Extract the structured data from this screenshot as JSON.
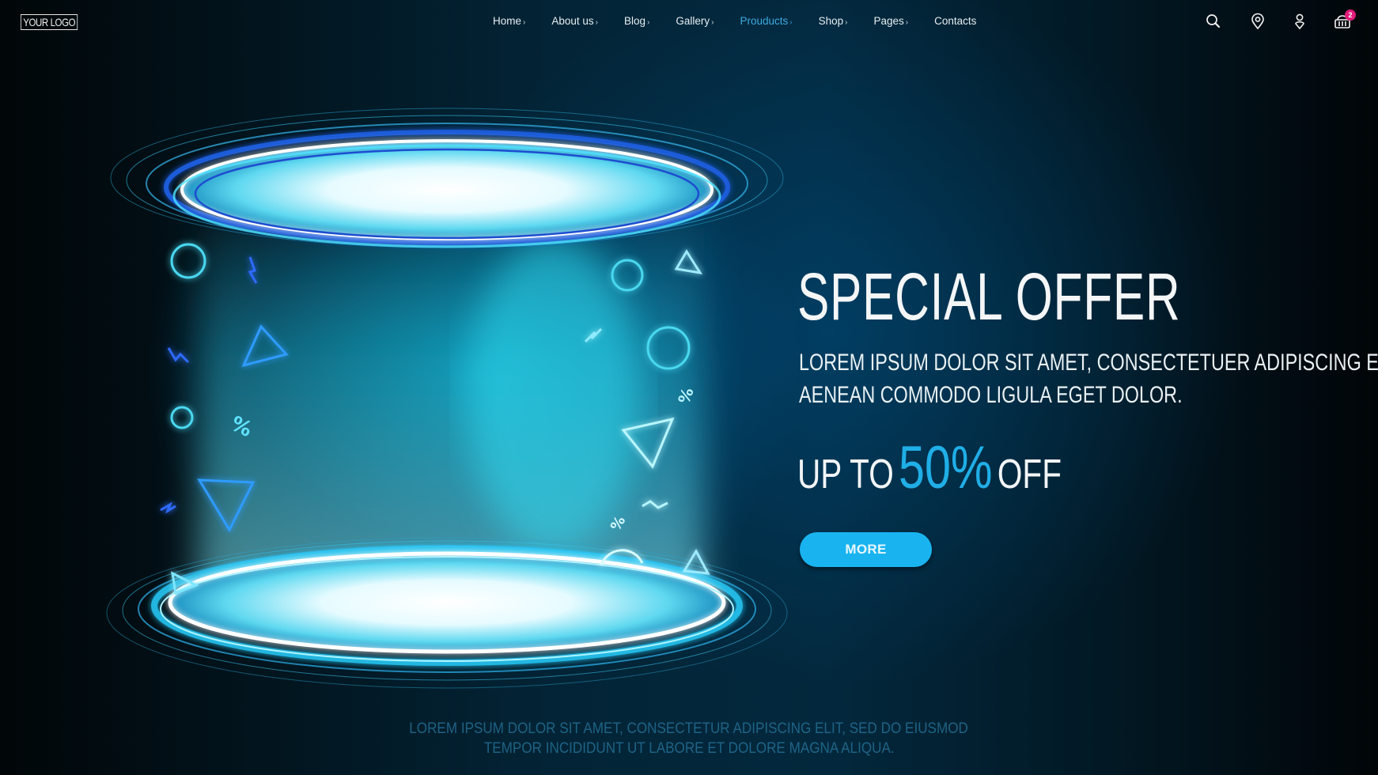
{
  "nav": {
    "logo": "YOUR LOGO",
    "items": [
      {
        "label": "Home",
        "has_submenu": true,
        "active": false
      },
      {
        "label": "About us",
        "has_submenu": true,
        "active": false
      },
      {
        "label": "Blog",
        "has_submenu": true,
        "active": false
      },
      {
        "label": "Gallery",
        "has_submenu": true,
        "active": false
      },
      {
        "label": "Prouducts",
        "has_submenu": true,
        "active": true
      },
      {
        "label": "Shop",
        "has_submenu": true,
        "active": false
      },
      {
        "label": "Pages",
        "has_submenu": true,
        "active": false
      },
      {
        "label": "Contacts",
        "has_submenu": false,
        "active": false
      }
    ],
    "chevron": "›",
    "icons": [
      "search-icon",
      "location-pin-icon",
      "user-icon",
      "basket-icon"
    ],
    "cart_count": "2"
  },
  "hero": {
    "headline": "SPECIAL OFFER",
    "sub_line_1": "LOREM IPSUM DOLOR SIT AMET, CONSECTETUER ADIPISCING ELIT.",
    "sub_line_2": "AENEAN COMMODO LIGULA EGET DOLOR.",
    "discount_prefix": "UP TO",
    "discount_value": "50%",
    "discount_suffix": "OFF",
    "cta_label": "MORE"
  },
  "footer": {
    "line_1": "LOREM IPSUM DOLOR SIT AMET, CONSECTETUR ADIPISCING ELIT, SED DO EIUSMOD",
    "line_2": "TEMPOR INCIDIDUNT UT LABORE ET DOLORE MAGNA ALIQUA."
  },
  "colors": {
    "accent": "#20aee6",
    "button": "#19b4f0",
    "badge": "#e01b7a",
    "active_nav": "#3fa9e0"
  }
}
